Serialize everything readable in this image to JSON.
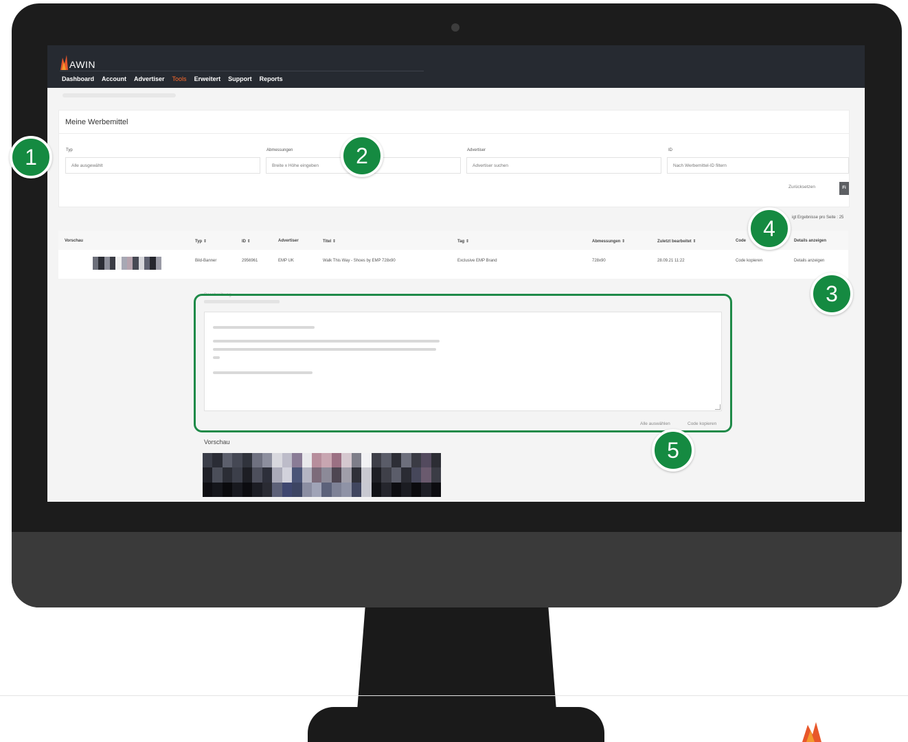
{
  "app": {
    "logo": "AWIN"
  },
  "nav": [
    {
      "label": "Dashboard",
      "active": false
    },
    {
      "label": "Account",
      "active": false
    },
    {
      "label": "Advertiser",
      "active": false
    },
    {
      "label": "Tools",
      "active": true
    },
    {
      "label": "Erweitert",
      "active": false
    },
    {
      "label": "Support",
      "active": false
    },
    {
      "label": "Reports",
      "active": false
    }
  ],
  "colors": {
    "topbar": "#262a31",
    "active_nav": "#ff6a2b",
    "highlight": "#158a41"
  },
  "card": {
    "title": "Meine Werbemittel"
  },
  "filters": {
    "typ": {
      "label": "Typ",
      "value": "Alle ausgewählt"
    },
    "abmessungen": {
      "label": "Abmessungen",
      "placeholder": "Breite x Höhe eingeben"
    },
    "advertiser": {
      "label": "Advertiser",
      "placeholder": "Advertiser suchen"
    },
    "id": {
      "label": "ID",
      "placeholder": "Nach Werbemittel-ID filtern"
    },
    "reset": "Zurücksetzen",
    "filter_button": "Fi"
  },
  "results": {
    "per_page_label": "igt  Ergebnisse pro Seite :",
    "per_page_value": "25"
  },
  "table": {
    "headers": [
      "Vorschau",
      "Typ ⇕",
      "ID ⇕",
      "Advertiser",
      "Titel ⇕",
      "Tag ⇕",
      "Abmessungen ⇕",
      "Zuletzt bearbeitet ⇕",
      "Code",
      "Details anzeigen"
    ],
    "rows": [
      {
        "typ": "Bild-Banner",
        "id": "2956961",
        "advertiser": "EMP UK",
        "titel": "Walk This Way - Shoes by EMP 728x90",
        "tag": "Exclusive EMP Brand",
        "abmessungen": "728x90",
        "zuletzt": "28.09.21 11:22",
        "code": "Code kopieren",
        "details": "Details anzeigen"
      }
    ]
  },
  "details": {
    "beschreibung": "Beschreibung",
    "select_all": "Alle auswählen",
    "copy_code": "Code kopieren",
    "vorschau": "Vorschau"
  },
  "badges": [
    "1",
    "2",
    "3",
    "4",
    "5"
  ]
}
